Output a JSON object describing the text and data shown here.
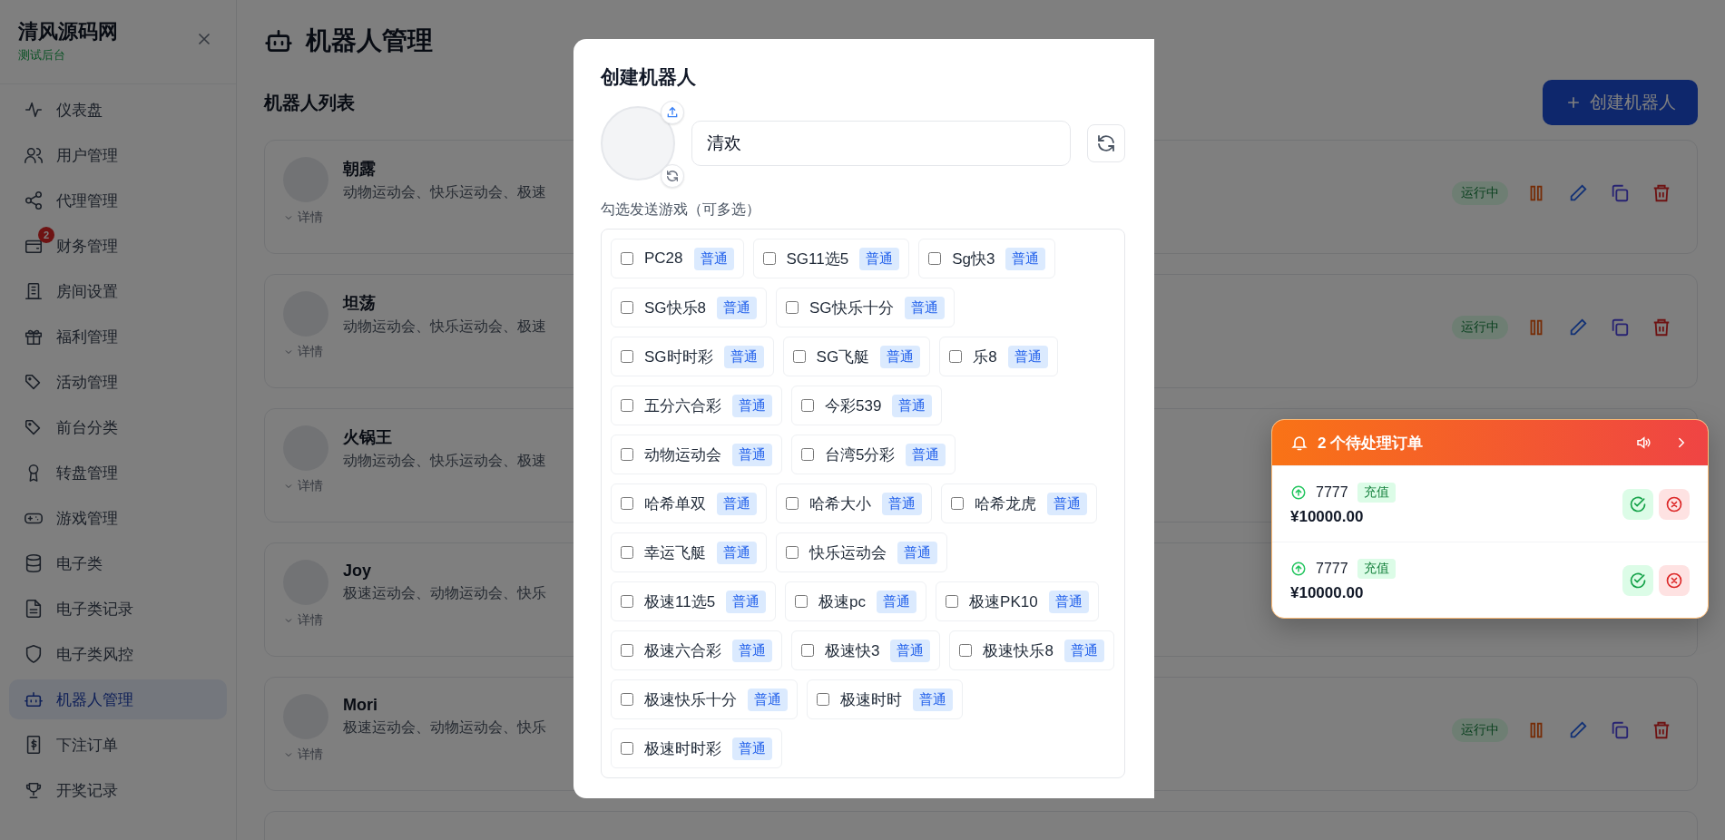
{
  "sidebar": {
    "brand": "清风源码网",
    "subtitle": "测试后台",
    "items": [
      {
        "label": "仪表盘",
        "selected": false
      },
      {
        "label": "用户管理",
        "selected": false
      },
      {
        "label": "代理管理",
        "selected": false
      },
      {
        "label": "财务管理",
        "badge": "2",
        "selected": false
      },
      {
        "label": "房间设置",
        "selected": false
      },
      {
        "label": "福利管理",
        "selected": false
      },
      {
        "label": "活动管理",
        "selected": false
      },
      {
        "label": "前台分类",
        "selected": false
      },
      {
        "label": "转盘管理",
        "selected": false
      },
      {
        "label": "游戏管理",
        "selected": false
      },
      {
        "label": "电子类",
        "selected": false
      },
      {
        "label": "电子类记录",
        "selected": false
      },
      {
        "label": "电子类风控",
        "selected": false
      },
      {
        "label": "机器人管理",
        "selected": true
      },
      {
        "label": "下注订单",
        "selected": false
      },
      {
        "label": "开奖记录",
        "selected": false
      }
    ]
  },
  "page": {
    "title": "机器人管理",
    "section_title": "机器人列表",
    "create_button": "创建机器人"
  },
  "robots": [
    {
      "name": "朝露",
      "games": "动物运动会、快乐运动会、极速",
      "details": "详情",
      "status": "运行中"
    },
    {
      "name": "坦荡",
      "games": "动物运动会、快乐运动会、极速",
      "details": "详情",
      "status": "运行中"
    },
    {
      "name": "火锅王",
      "games": "动物运动会、快乐运动会、极速",
      "details": "详情"
    },
    {
      "name": "Joy",
      "games": "极速运动会、动物运动会、快乐",
      "details": "详情"
    },
    {
      "name": "Mori",
      "games": "极速运动会、动物运动会、快乐",
      "details": "详情",
      "status": "运行中"
    }
  ],
  "modal": {
    "title": "创建机器人",
    "name_value": "清欢",
    "games_label": "勾选发送游戏（可多选）",
    "games": [
      {
        "name": "PC28",
        "tag": "普通",
        "checked": false
      },
      {
        "name": "SG11选5",
        "tag": "普通",
        "checked": false
      },
      {
        "name": "Sg快3",
        "tag": "普通",
        "checked": false
      },
      {
        "name": "SG快乐8",
        "tag": "普通",
        "checked": false
      },
      {
        "name": "SG快乐十分",
        "tag": "普通",
        "checked": false
      },
      {
        "name": "SG时时彩",
        "tag": "普通",
        "checked": false
      },
      {
        "name": "SG飞艇",
        "tag": "普通",
        "checked": false
      },
      {
        "name": "乐8",
        "tag": "普通",
        "checked": false
      },
      {
        "name": "五分六合彩",
        "tag": "普通",
        "checked": false
      },
      {
        "name": "今彩539",
        "tag": "普通",
        "checked": false
      },
      {
        "name": "动物运动会",
        "tag": "普通",
        "checked": false
      },
      {
        "name": "台湾5分彩",
        "tag": "普通",
        "checked": false
      },
      {
        "name": "哈希单双",
        "tag": "普通",
        "checked": false
      },
      {
        "name": "哈希大小",
        "tag": "普通",
        "checked": false
      },
      {
        "name": "哈希龙虎",
        "tag": "普通",
        "checked": false
      },
      {
        "name": "幸运飞艇",
        "tag": "普通",
        "checked": false
      },
      {
        "name": "快乐运动会",
        "tag": "普通",
        "checked": false
      },
      {
        "name": "极速11选5",
        "tag": "普通",
        "checked": false
      },
      {
        "name": "极速pc",
        "tag": "普通",
        "checked": false
      },
      {
        "name": "极速PK10",
        "tag": "普通",
        "checked": false
      },
      {
        "name": "极速六合彩",
        "tag": "普通",
        "checked": false
      },
      {
        "name": "极速快3",
        "tag": "普通",
        "checked": false
      },
      {
        "name": "极速快乐8",
        "tag": "普通",
        "checked": false
      },
      {
        "name": "极速快乐十分",
        "tag": "普通",
        "checked": false
      },
      {
        "name": "极速时时",
        "tag": "普通",
        "checked": false
      },
      {
        "name": "极速时时彩",
        "tag": "普通",
        "checked": false
      }
    ]
  },
  "notification": {
    "title": "2 个待处理订单",
    "orders": [
      {
        "user": "7777",
        "type": "充值",
        "amount": "¥10000.00"
      },
      {
        "user": "7777",
        "type": "充值",
        "amount": "¥10000.00"
      }
    ]
  }
}
